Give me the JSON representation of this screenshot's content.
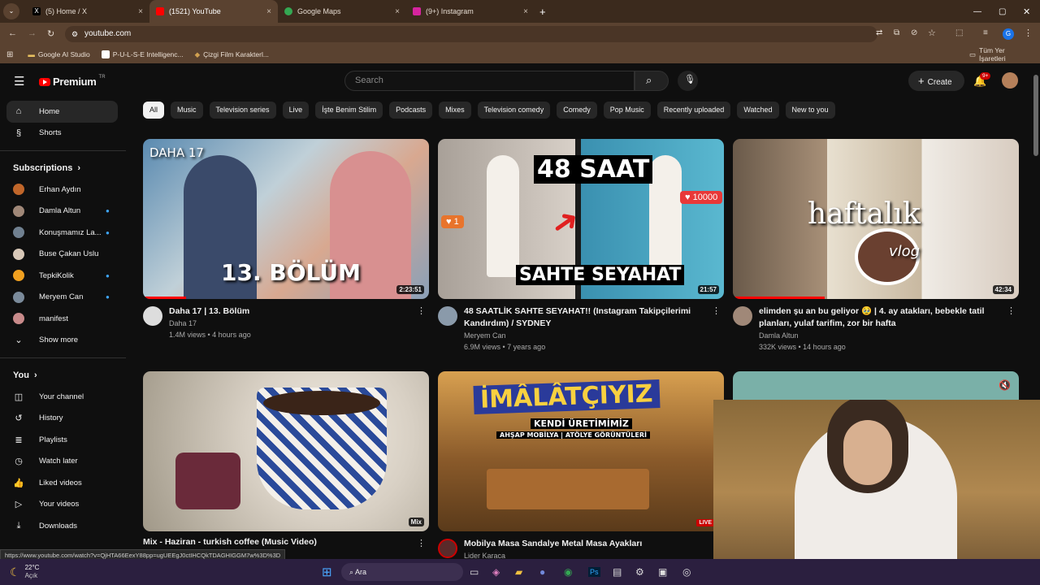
{
  "browser": {
    "tabs": [
      {
        "label": "(5) Home / X",
        "icon_color": "#000000"
      },
      {
        "label": "(1521) YouTube",
        "icon_color": "#ff0000"
      },
      {
        "label": "Google Maps",
        "icon_color": "#34a853"
      },
      {
        "label": "(9+) Instagram",
        "icon_color": "#d6249f"
      }
    ],
    "url": "youtube.com",
    "bookmarks": [
      "Google AI Studio",
      "P-U-L-S-E Intelligenc...",
      "Çizgi Film Karakterl..."
    ],
    "all_bookmarks": "Tüm Yer İşaretleri",
    "profile_initial": "G"
  },
  "header": {
    "logo": "Premium",
    "logo_country": "TR",
    "search_placeholder": "Search",
    "create_label": "Create",
    "notifications_badge": "9+"
  },
  "sidebar": {
    "main": [
      {
        "label": "Home",
        "icon": "home-icon"
      },
      {
        "label": "Shorts",
        "icon": "shorts-icon"
      }
    ],
    "subscriptions_title": "Subscriptions",
    "subscriptions": [
      {
        "label": "Erhan Aydın",
        "dot": false,
        "color": "#c0662a"
      },
      {
        "label": "Damla Altun",
        "dot": true,
        "color": "#a08878"
      },
      {
        "label": "Konuşmamız La...",
        "dot": true,
        "color": "#708090"
      },
      {
        "label": "Buse Çakan Uslu",
        "dot": false,
        "color": "#d8c8b8"
      },
      {
        "label": "TepkiKolik",
        "dot": true,
        "color": "#f0a020"
      },
      {
        "label": "Meryem Can",
        "dot": true,
        "color": "#7a8a9a"
      },
      {
        "label": "manifest",
        "dot": false,
        "color": "#c88a8a"
      }
    ],
    "show_more": "Show more",
    "you_title": "You",
    "you_items": [
      {
        "label": "Your channel",
        "icon": "channel-icon"
      },
      {
        "label": "History",
        "icon": "history-icon"
      },
      {
        "label": "Playlists",
        "icon": "playlists-icon"
      },
      {
        "label": "Watch later",
        "icon": "watch-later-icon"
      },
      {
        "label": "Liked videos",
        "icon": "like-icon"
      },
      {
        "label": "Your videos",
        "icon": "your-videos-icon"
      },
      {
        "label": "Downloads",
        "icon": "download-icon"
      }
    ]
  },
  "chips": [
    "All",
    "Music",
    "Television series",
    "Live",
    "İşte Benim Stilim",
    "Podcasts",
    "Mixes",
    "Television comedy",
    "Comedy",
    "Pop Music",
    "Recently uploaded",
    "Watched",
    "New to you"
  ],
  "videos": [
    {
      "title": "Daha 17 | 13. Bölüm",
      "channel": "Daha 17",
      "stats": "1.4M views • 4 hours ago",
      "duration": "2:23:51",
      "thumb_text": "13. BÖLÜM",
      "thumb_corner": "DAHA 17",
      "progress": 0.15
    },
    {
      "title": "48 SAATLİK SAHTE SEYAHAT!! (Instagram Takipçilerimi Kandırdım) / SYDNEY",
      "channel": "Meryem Can",
      "stats": "6.9M views • 7 years ago",
      "duration": "21:57",
      "thumb_text": "48 SAAT",
      "thumb_text2": "SAHTE SEYAHAT",
      "heart_left": "1",
      "heart_right": "10000"
    },
    {
      "title": "elimden şu an bu geliyor 🥹 | 4. ay atakları, bebekle tatil planları, yulaf tarifim, zor bir hafta",
      "channel": "Damla Altun",
      "stats": "332K views • 14 hours ago",
      "duration": "42:34",
      "thumb_text": "haftalık",
      "thumb_text2": "vlog",
      "progress": 0.32
    },
    {
      "title": "Mix - Haziran - turkish coffee (Music Video)",
      "channel": "",
      "stats": "",
      "duration": "Mix"
    },
    {
      "title": "Mobilya Masa Sandalye Metal Masa Ayakları",
      "channel": "Lider Karaca",
      "stats": "",
      "thumb_text": "İMÂLÂTÇIYIZ",
      "thumb_text2": "KENDİ ÜRETİMİMİZ",
      "thumb_text3": "AHŞAP MOBİLYA | ATÖLYE GÖRÜNTÜLERİ",
      "live": "LIVE"
    }
  ],
  "status_url": "https://www.youtube.com/watch?v=QjHTA66EexY88pp=ugUEEgJ0ctIHCQkTDAGHIGGM7w%3D%3D",
  "taskbar": {
    "temp": "22°C",
    "weather": "Açık",
    "search": "Ara"
  }
}
